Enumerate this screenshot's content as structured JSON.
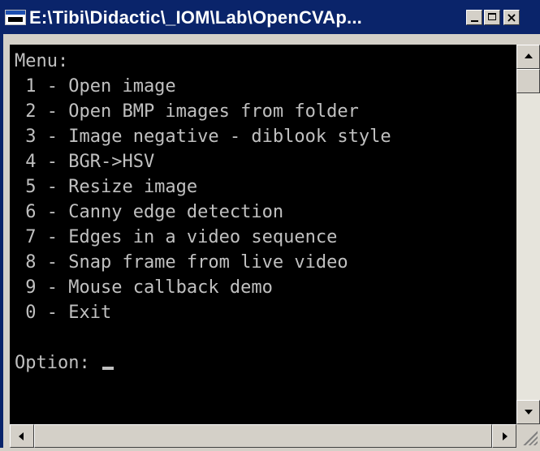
{
  "window": {
    "title": "E:\\Tibi\\Didactic\\_IOM\\Lab\\OpenCVAp...",
    "minimize_label": "",
    "maximize_label": "",
    "close_label": "×"
  },
  "console": {
    "header": "Menu:",
    "items": [
      " 1 - Open image",
      " 2 - Open BMP images from folder",
      " 3 - Image negative - diblook style",
      " 4 - BGR->HSV",
      " 5 - Resize image",
      " 6 - Canny edge detection",
      " 7 - Edges in a video sequence",
      " 8 - Snap frame from live video",
      " 9 - Mouse callback demo",
      " 0 - Exit"
    ],
    "prompt": "Option: "
  },
  "colors": {
    "title_bar": "#0a246a",
    "console_bg": "#000000",
    "console_text": "#c0c0c0",
    "chrome": "#d4d0c8"
  },
  "icons": {
    "app": "console-app-icon",
    "minimize": "minimize-icon",
    "maximize": "maximize-icon",
    "close": "close-icon",
    "scroll_up": "arrow-up-icon",
    "scroll_down": "arrow-down-icon",
    "scroll_left": "arrow-left-icon",
    "scroll_right": "arrow-right-icon"
  }
}
